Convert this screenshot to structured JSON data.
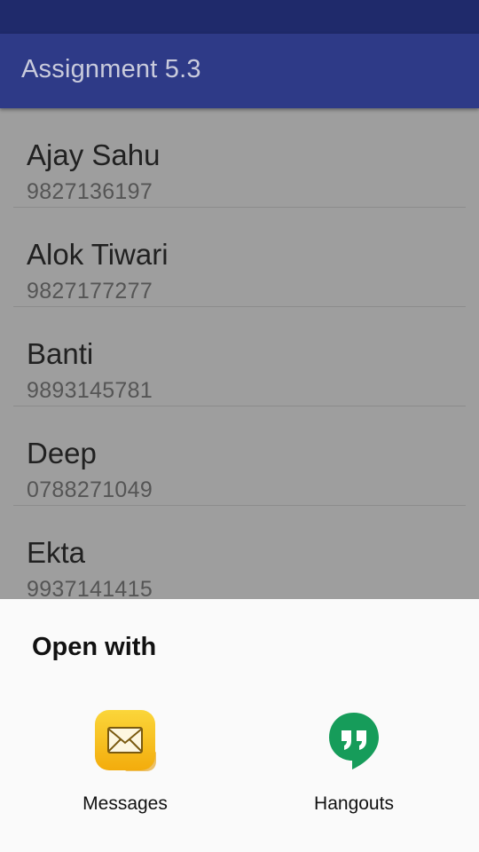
{
  "app_bar": {
    "title": "Assignment 5.3"
  },
  "contacts": [
    {
      "name": "Ajay Sahu",
      "phone": "9827136197"
    },
    {
      "name": "Alok Tiwari",
      "phone": "9827177277"
    },
    {
      "name": "Banti",
      "phone": "9893145781"
    },
    {
      "name": "Deep",
      "phone": "0788271049"
    },
    {
      "name": "Ekta",
      "phone": "9937141415"
    }
  ],
  "share_sheet": {
    "title": "Open with",
    "apps": [
      {
        "label": "Messages",
        "icon": "envelope-icon",
        "color": "#f7c21a"
      },
      {
        "label": "Hangouts",
        "icon": "quote-bubble-icon",
        "color": "#169c5a"
      }
    ]
  },
  "colors": {
    "status_bar": "#1f2a6b",
    "app_bar": "#2e3a87",
    "scrim_background": "#9e9e9e",
    "sheet_background": "#fafafa"
  }
}
